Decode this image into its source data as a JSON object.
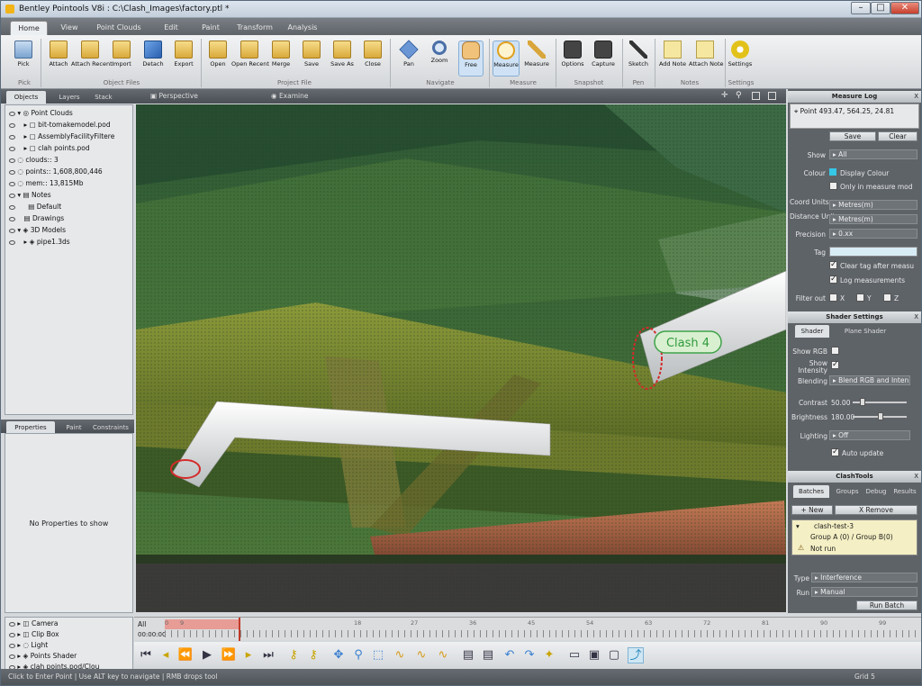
{
  "window": {
    "title": "Bentley Pointools V8i : C:\\Clash_Images\\factory.ptl *",
    "minimize": "–",
    "maximize": "□",
    "close": "✕"
  },
  "ribbon_tabs": [
    "Home",
    "View",
    "Point Clouds",
    "Edit",
    "Paint",
    "Transform",
    "Analysis"
  ],
  "ribbon": {
    "buttons": [
      {
        "label": "Pick",
        "icon": "pick-icon"
      },
      {
        "label": "Attach",
        "icon": "folder-icon"
      },
      {
        "label": "Attach Recent",
        "icon": "folder-icon"
      },
      {
        "label": "Import",
        "icon": "folder-icon"
      },
      {
        "label": "Detach",
        "icon": "cube-icon"
      },
      {
        "label": "Export",
        "icon": "export-icon"
      },
      {
        "label": "Open",
        "icon": "folder-icon"
      },
      {
        "label": "Open Recent",
        "icon": "folder-icon"
      },
      {
        "label": "Merge",
        "icon": "folder-icon"
      },
      {
        "label": "Save",
        "icon": "save-icon"
      },
      {
        "label": "Save As",
        "icon": "save-icon"
      },
      {
        "label": "Close",
        "icon": "close-file-icon"
      },
      {
        "label": "Pan",
        "icon": "pan-icon"
      },
      {
        "label": "Zoom",
        "icon": "zoom-icon"
      },
      {
        "label": "Free",
        "icon": "hand-icon"
      },
      {
        "label": "Measure",
        "icon": "measure-xyz-icon"
      },
      {
        "label": "Measure",
        "icon": "measure-ruler-icon"
      },
      {
        "label": "Options",
        "icon": "camera-icon"
      },
      {
        "label": "Capture",
        "icon": "camera-icon"
      },
      {
        "label": "Sketch",
        "icon": "pen-icon"
      },
      {
        "label": "Add Note",
        "icon": "note-icon"
      },
      {
        "label": "Attach Note",
        "icon": "note-icon"
      },
      {
        "label": "Settings",
        "icon": "gear-icon"
      }
    ],
    "groups": [
      "Pick",
      "Object Files",
      "Project File",
      "Navigate",
      "Measure",
      "Snapshot",
      "Pen",
      "Notes",
      "Settings"
    ]
  },
  "left_tabs": [
    "Objects",
    "Layers",
    "Stack"
  ],
  "object_tree": [
    {
      "label": "Point Clouds",
      "indent": 0
    },
    {
      "label": "bit-tomakemodel.pod",
      "indent": 1
    },
    {
      "label": "AssemblyFacilityFiltere",
      "indent": 1
    },
    {
      "label": "clah points.pod",
      "indent": 1
    },
    {
      "label": "clouds:: 3",
      "indent": 0
    },
    {
      "label": "points:: 1,608,800,446",
      "indent": 0
    },
    {
      "label": "mem:: 13,815Mb",
      "indent": 0
    },
    {
      "label": "Notes",
      "indent": 0
    },
    {
      "label": "Default",
      "indent": 1
    },
    {
      "label": "Drawings",
      "indent": 0
    },
    {
      "label": "3D Models",
      "indent": 0
    },
    {
      "label": "pipe1.3ds",
      "indent": 1
    }
  ],
  "properties_tabs": [
    "Properties",
    "Paint",
    "Constraints"
  ],
  "properties_empty": "No Properties to show",
  "viewport_tabs": [
    "Perspective",
    "Examine"
  ],
  "clash_label": "Clash 4",
  "measure_log": {
    "title": "Measure Log",
    "entry": "Point 493.47, 564.25, 24.81",
    "save": "Save",
    "clear": "Clear",
    "show_label": "Show",
    "show_value": "All",
    "colour_label": "Colour",
    "colour_value": "Display Colour",
    "only_measure": "Only in measure mod",
    "coord_units_label": "Coord Units",
    "coord_units": "Metres(m)",
    "distance_units_label": "Distance Units",
    "distance_units": "Metres(m)",
    "precision_label": "Precision",
    "precision": "0.xx",
    "tag_label": "Tag",
    "clear_tag": "Clear tag after measu",
    "log_measurements": "Log measurements",
    "filter_label": "Filter out",
    "fx": "X",
    "fy": "Y",
    "fz": "Z"
  },
  "shader": {
    "title": "Shader Settings",
    "tabs": [
      "Shader",
      "Plane Shader"
    ],
    "show_rgb": "Show RGB",
    "show_intensity": "Show Intensity",
    "blending_label": "Blending",
    "blending": "Blend RGB and Inten",
    "contrast_label": "Contrast",
    "contrast": "50.00",
    "brightness_label": "Brightness",
    "brightness": "180.00",
    "lighting_label": "Lighting",
    "lighting": "Off",
    "auto_update": "Auto update"
  },
  "clash": {
    "title": "ClashTools",
    "tabs": [
      "Batches",
      "Groups",
      "Debug",
      "Results"
    ],
    "new": "+ New",
    "remove": "X Remove",
    "item_name": "clash-test-3",
    "item_groups": "Group A (0) / Group B(0)",
    "item_status": "Not run",
    "type_label": "Type",
    "type": "Interference",
    "run_label": "Run",
    "run": "Manual",
    "run_batch": "Run Batch"
  },
  "bottom_list": [
    "Camera",
    "Clip Box",
    "Light",
    "Points Shader",
    "clah points.pod/Clou"
  ],
  "timeline": {
    "all_label": "All",
    "time": "00:00:00",
    "ticks": [
      "0",
      "9",
      "18",
      "27",
      "36",
      "45",
      "54",
      "63",
      "72",
      "81",
      "90",
      "99"
    ]
  },
  "status": {
    "left": "Click to Enter Point | Use ALT key to navigate | RMB drops tool",
    "right": "Grid 5"
  },
  "colors": {
    "accent": "#3a8fd6",
    "clash": "#d42a2a",
    "panel": "#5e6368"
  }
}
